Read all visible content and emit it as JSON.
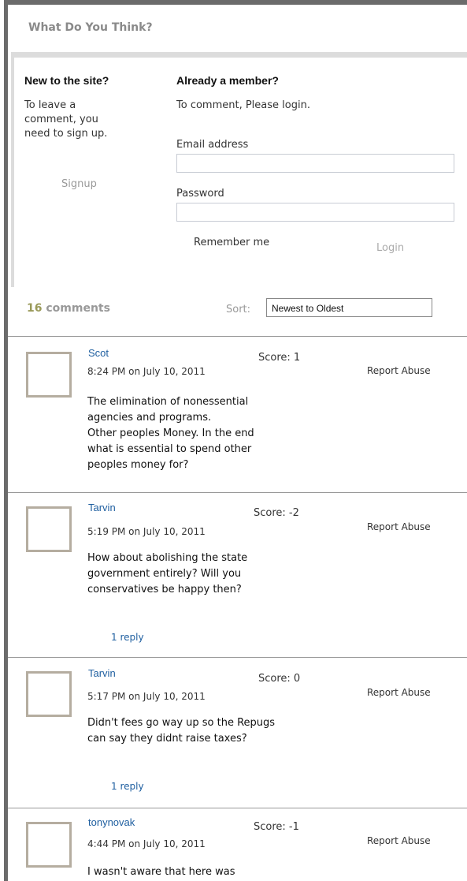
{
  "header": {
    "title": "What Do You Think?"
  },
  "new_user": {
    "heading": "New to the site?",
    "text_lines": [
      "To leave a",
      "comment, you",
      "need to sign up."
    ],
    "signup_label": "Signup"
  },
  "member": {
    "heading": "Already a member?",
    "instruction": "To comment, Please login.",
    "email_label": "Email address",
    "email_value": "",
    "password_label": "Password",
    "password_value": "",
    "remember_label": "Remember me",
    "login_label": "Login"
  },
  "comments_bar": {
    "count": "16",
    "count_label": "comments",
    "sort_label": "Sort:",
    "sort_value": "Newest to Oldest"
  },
  "comments": [
    {
      "author": "Scot",
      "date": "8:24 PM on July 10, 2011",
      "score": "Score: 1",
      "report": "Report Abuse",
      "lines": [
        "The elimination of nonessential",
        "agencies and programs.",
        "Other peoples Money. In the end",
        "what is essential to spend other",
        "peoples money for?"
      ],
      "reply": ""
    },
    {
      "author": "Tarvin",
      "date": "5:19 PM on July 10, 2011",
      "score": "Score: -2",
      "report": "Report Abuse",
      "lines": [
        "How about abolishing the state",
        "government entirely? Will you",
        "conservatives be happy then?"
      ],
      "reply": "1 reply"
    },
    {
      "author": "Tarvin",
      "date": "5:17 PM on July 10, 2011",
      "score": "Score: 0",
      "report": "Report Abuse",
      "lines": [
        "Didn't fees go way up so the Repugs",
        "can say they didnt raise taxes?"
      ],
      "reply": "1 reply"
    },
    {
      "author": "tonynovak",
      "date": "4:44 PM on July 10, 2011",
      "score": "Score: -1",
      "report": "Report Abuse",
      "lines": [
        "I wasn't aware that here was"
      ],
      "reply": ""
    }
  ]
}
